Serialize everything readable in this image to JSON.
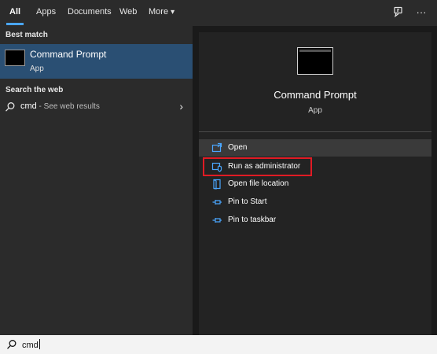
{
  "tabs": [
    {
      "label": "All"
    },
    {
      "label": "Apps"
    },
    {
      "label": "Documents"
    },
    {
      "label": "Web"
    },
    {
      "label": "More"
    }
  ],
  "topbar": {
    "more_arrow": "▾",
    "feedback_icon": "feedback-icon",
    "more_options": "···"
  },
  "best_match": {
    "section_label": "Best match",
    "title": "Command Prompt",
    "subtitle": "App"
  },
  "web": {
    "section_label": "Search the web",
    "query": "cmd",
    "suffix": " - See web results",
    "chevron": "›"
  },
  "preview": {
    "title": "Command Prompt",
    "subtitle": "App"
  },
  "actions": [
    {
      "label": "Open",
      "icon": "open-icon"
    },
    {
      "label": "Run as administrator",
      "icon": "shield-icon"
    },
    {
      "label": "Open file location",
      "icon": "folder-icon"
    },
    {
      "label": "Pin to Start",
      "icon": "pin-icon"
    },
    {
      "label": "Pin to taskbar",
      "icon": "pin-icon"
    }
  ],
  "search": {
    "value": "cmd"
  },
  "colors": {
    "accent": "#4aa6ff",
    "selection": "#2a4f73",
    "highlight_box": "#e01b24"
  }
}
